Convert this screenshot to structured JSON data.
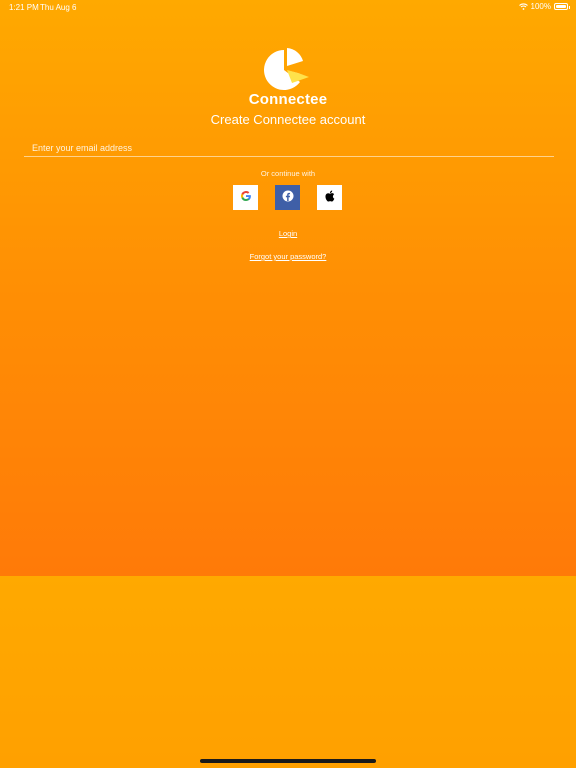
{
  "status_bar": {
    "time": "1:21 PM",
    "date": "Thu Aug 6",
    "battery": "100%"
  },
  "brand": {
    "name": "Connectee",
    "logo_icon": "connectee-logo-icon"
  },
  "form": {
    "title": "Create Connectee account",
    "email_placeholder": "Enter your email address",
    "email_value": ""
  },
  "social": {
    "label": "Or continue with",
    "providers": [
      "google",
      "facebook",
      "apple"
    ]
  },
  "links": {
    "login": "Login",
    "forgot_password": "Forgot your password?"
  },
  "colors": {
    "gradient_top": "#ffa900",
    "gradient_bottom": "#ff7a08",
    "facebook_blue": "#3f5fa7",
    "text": "#ffffff"
  }
}
